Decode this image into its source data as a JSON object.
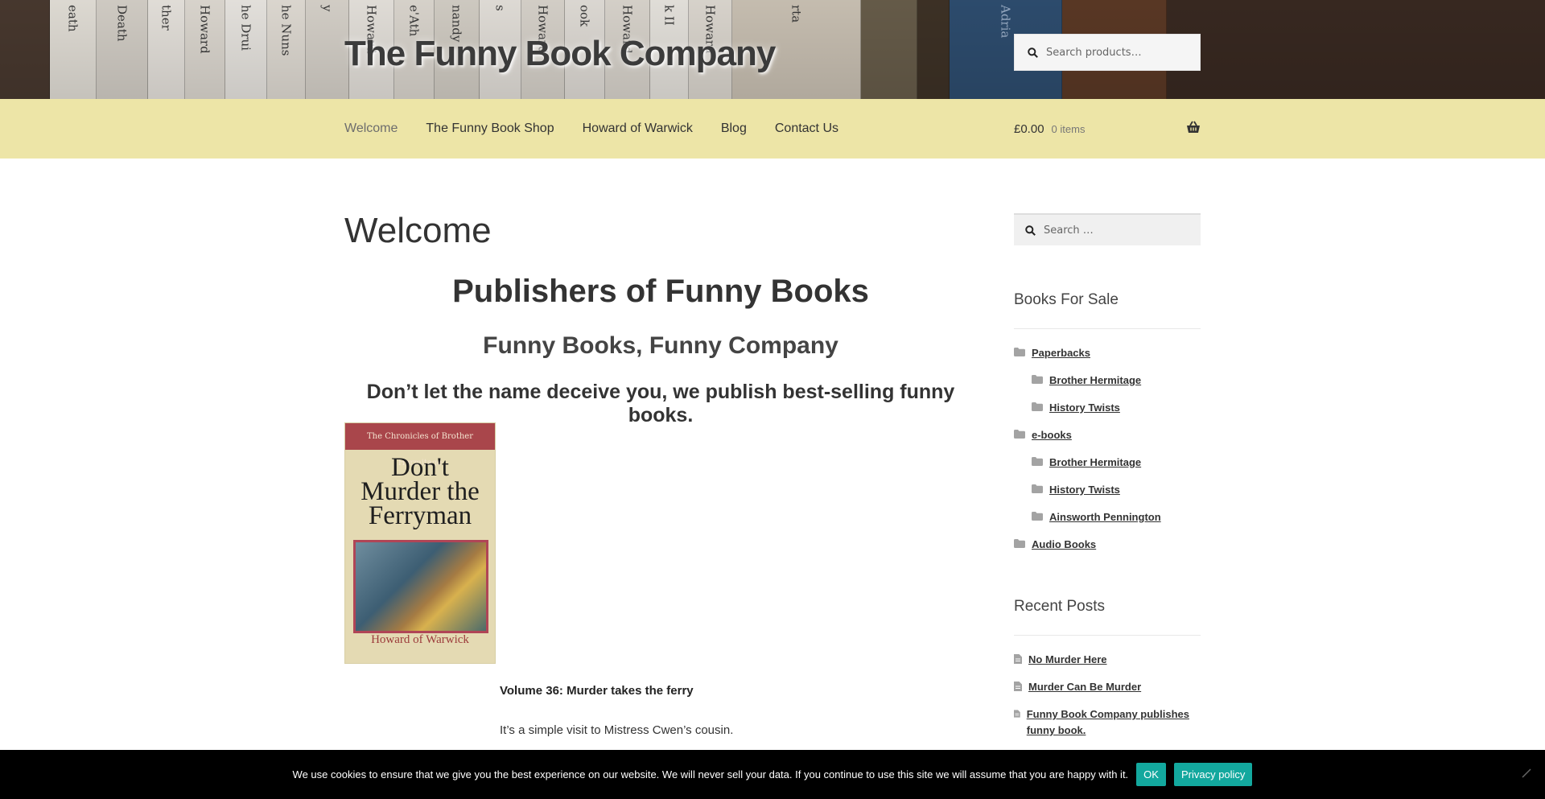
{
  "header": {
    "site_title": "The Funny Book Company",
    "search_placeholder": "Search products…",
    "spine_texts": [
      "",
      "eath",
      "Death",
      "ther",
      "Howard",
      "he Drui",
      "he Nuns",
      "y",
      "Howard",
      "e'Ath",
      "nandy",
      "s",
      "Howard",
      "ook",
      "Howard",
      "k II",
      "Howard",
      "rta",
      "",
      "",
      "Adria",
      ""
    ]
  },
  "nav": {
    "items": [
      "Welcome",
      "The Funny Book Shop",
      "Howard of Warwick",
      "Blog",
      "Contact Us"
    ],
    "cart_amount": "£0.00",
    "cart_count": "0 items"
  },
  "main": {
    "page_title": "Welcome",
    "heading1": "Publishers of Funny Books",
    "heading2": "Funny Books, Funny Company",
    "heading3": "Don’t let the name deceive you, we publish best-selling funny books.",
    "cover": {
      "series": "The Chronicles of Brother Hermitage",
      "title_line1": "Don't",
      "title_line2": "Murder the",
      "title_line3": "Ferryman",
      "author": "Howard of Warwick"
    },
    "volume_label": "Volume 36: Murder takes the ferry",
    "intro_text": "It’s a simple visit to Mistress Cwen’s cousin."
  },
  "sidebar": {
    "search_placeholder": "Search …",
    "books_title": "Books For Sale",
    "categories": [
      {
        "label": "Paperbacks",
        "level": 0
      },
      {
        "label": "Brother Hermitage",
        "level": 1
      },
      {
        "label": "History Twists",
        "level": 1
      },
      {
        "label": "e-books",
        "level": 0
      },
      {
        "label": "Brother Hermitage",
        "level": 1
      },
      {
        "label": "History Twists",
        "level": 1
      },
      {
        "label": "Ainsworth Pennington",
        "level": 1
      },
      {
        "label": "Audio Books",
        "level": 0
      }
    ],
    "posts_title": "Recent Posts",
    "posts": [
      "No Murder Here",
      "Murder Can Be Murder",
      "Funny Book Company publishes funny book."
    ]
  },
  "cookie": {
    "text": "We use cookies to ensure that we give you the best experience on our website. We will never sell your data. If you continue to use this site we will assume that you are happy with it.",
    "ok_label": "OK",
    "policy_label": "Privacy policy"
  },
  "colors": {
    "nav_bg": "#ede5a7",
    "cookie_button": "#13a89e",
    "cover_band": "#a9464b"
  }
}
